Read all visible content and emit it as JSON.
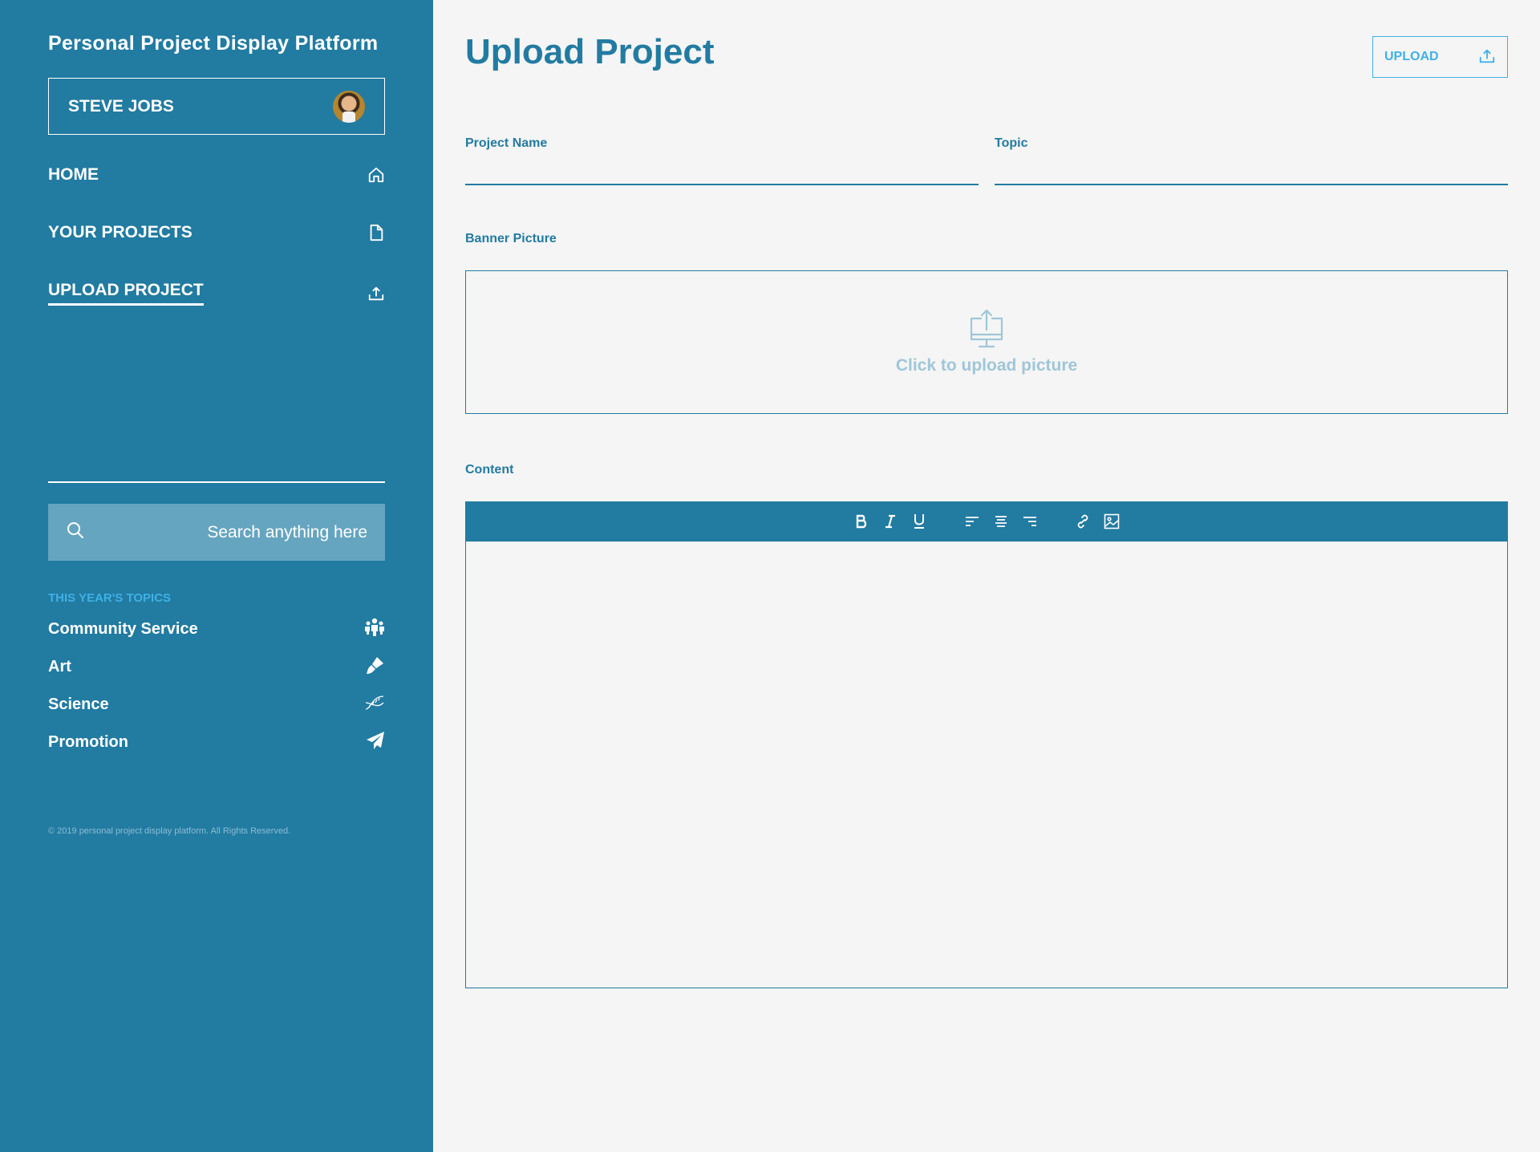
{
  "app": {
    "title": "Personal Project Display Platform"
  },
  "user": {
    "name": "STEVE JOBS"
  },
  "nav": [
    {
      "label": "HOME",
      "icon": "home-icon",
      "active": false
    },
    {
      "label": "YOUR PROJECTS",
      "icon": "document-icon",
      "active": false
    },
    {
      "label": "UPLOAD PROJECT",
      "icon": "upload-icon",
      "active": true
    }
  ],
  "search": {
    "placeholder": "Search anything here",
    "icon": "search-icon"
  },
  "topics": {
    "heading": "THIS YEAR'S TOPICS",
    "items": [
      {
        "label": "Community Service",
        "icon": "people-icon"
      },
      {
        "label": "Art",
        "icon": "brush-icon"
      },
      {
        "label": "Science",
        "icon": "dna-icon"
      },
      {
        "label": "Promotion",
        "icon": "paper-plane-icon"
      }
    ]
  },
  "footer": {
    "text": "© 2019 personal project display platform. All Rights Reserved."
  },
  "main": {
    "title": "Upload Project",
    "upload_button": {
      "label": "UPLOAD",
      "icon": "upload-icon"
    },
    "fields": {
      "project_name": {
        "label": "Project Name",
        "value": ""
      },
      "topic": {
        "label": "Topic",
        "value": ""
      },
      "banner": {
        "label": "Banner Picture",
        "prompt": "Click to upload picture",
        "icon": "upload-computer-icon"
      },
      "content": {
        "label": "Content",
        "value": ""
      }
    },
    "toolbar": [
      "bold-icon",
      "italic-icon",
      "underline-icon",
      "align-left-icon",
      "align-center-icon",
      "align-right-icon",
      "link-icon",
      "image-icon"
    ]
  },
  "colors": {
    "primary": "#227ba1",
    "accent": "#3fb1e6",
    "background": "#f5f5f5",
    "search_bg": "#66a5c0",
    "muted_text": "#9fc6d8"
  }
}
